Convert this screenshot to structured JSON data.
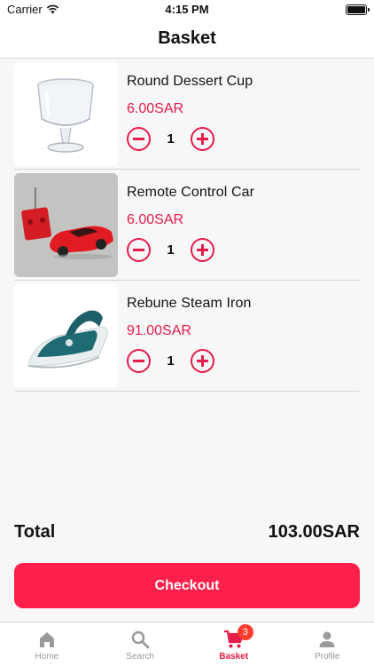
{
  "status_bar": {
    "carrier": "Carrier",
    "time": "4:15 PM"
  },
  "header": {
    "title": "Basket"
  },
  "basket": {
    "items": [
      {
        "name": "Round Dessert Cup",
        "price": "6.00SAR",
        "quantity": "1"
      },
      {
        "name": "Remote Control Car",
        "price": "6.00SAR",
        "quantity": "1"
      },
      {
        "name": "Rebune Steam Iron",
        "price": "91.00SAR",
        "quantity": "1"
      }
    ]
  },
  "summary": {
    "total_label": "Total",
    "total_value": "103.00SAR",
    "checkout_label": "Checkout"
  },
  "tabbar": {
    "tabs": [
      {
        "label": "Home",
        "icon": "home-icon"
      },
      {
        "label": "Search",
        "icon": "search-icon"
      },
      {
        "label": "Basket",
        "icon": "cart-icon",
        "badge": "3"
      },
      {
        "label": "Profile",
        "icon": "profile-icon"
      }
    ]
  },
  "colors": {
    "accent": "#e61c4a",
    "checkout": "#ff1f4b",
    "badge": "#ff3b30",
    "inactive": "#9a9a9a"
  }
}
